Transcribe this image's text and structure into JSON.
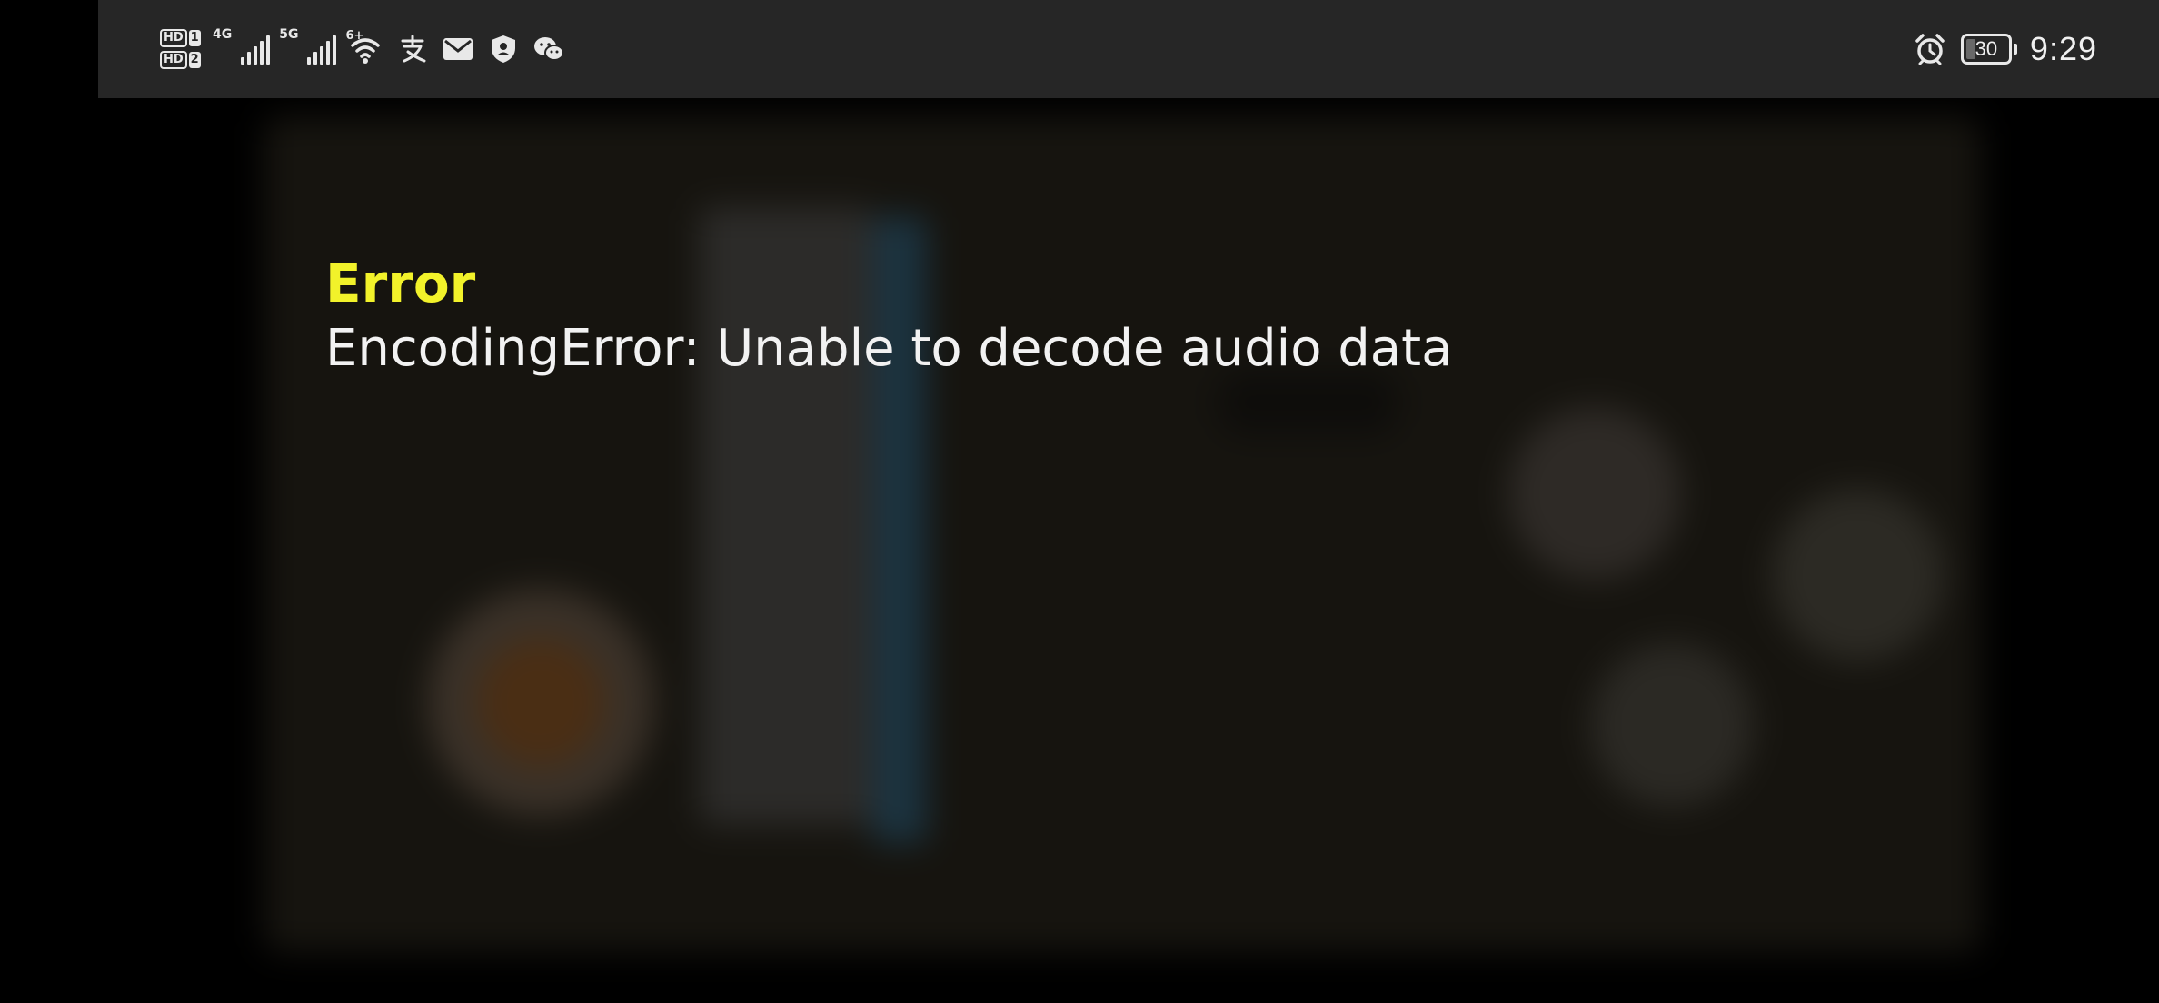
{
  "status_bar": {
    "sim1_label": "HD",
    "sim1_num": "1",
    "sim2_label": "HD",
    "sim2_num": "2",
    "network1": "4G",
    "network2": "5G",
    "wifi_tag": "6+",
    "icons": [
      "hd-sim-icon",
      "signal-4g-icon",
      "signal-5g-icon",
      "wifi-6-icon",
      "alipay-icon",
      "mail-icon",
      "shield-icon",
      "wechat-icon"
    ],
    "alarm_icon": "alarm-icon",
    "battery_level": "30",
    "time": "9:29"
  },
  "error": {
    "title": "Error",
    "message": "EncodingError: Unable to decode audio data"
  },
  "colors": {
    "status_bar_bg": "#262626",
    "error_title": "#f2f22a",
    "error_message": "#f2f2f2",
    "background": "#000000"
  }
}
